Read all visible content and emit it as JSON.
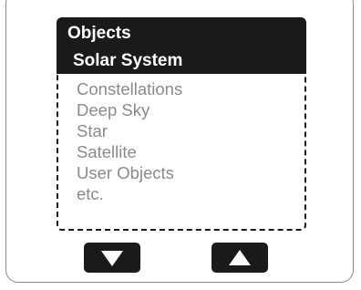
{
  "menu": {
    "title": "Objects",
    "selected_item": "Solar System",
    "items": [
      "Constellations",
      "Deep Sky",
      "Star",
      "Satellite",
      "User Objects",
      "etc."
    ]
  },
  "buttons": {
    "down_icon": "arrow-down-icon",
    "up_icon": "arrow-up-icon"
  },
  "colors": {
    "header_background": "#1a1a1a",
    "header_text": "#ffffff",
    "item_text": "#8a8a8a",
    "button_background": "#1a1a1a"
  }
}
